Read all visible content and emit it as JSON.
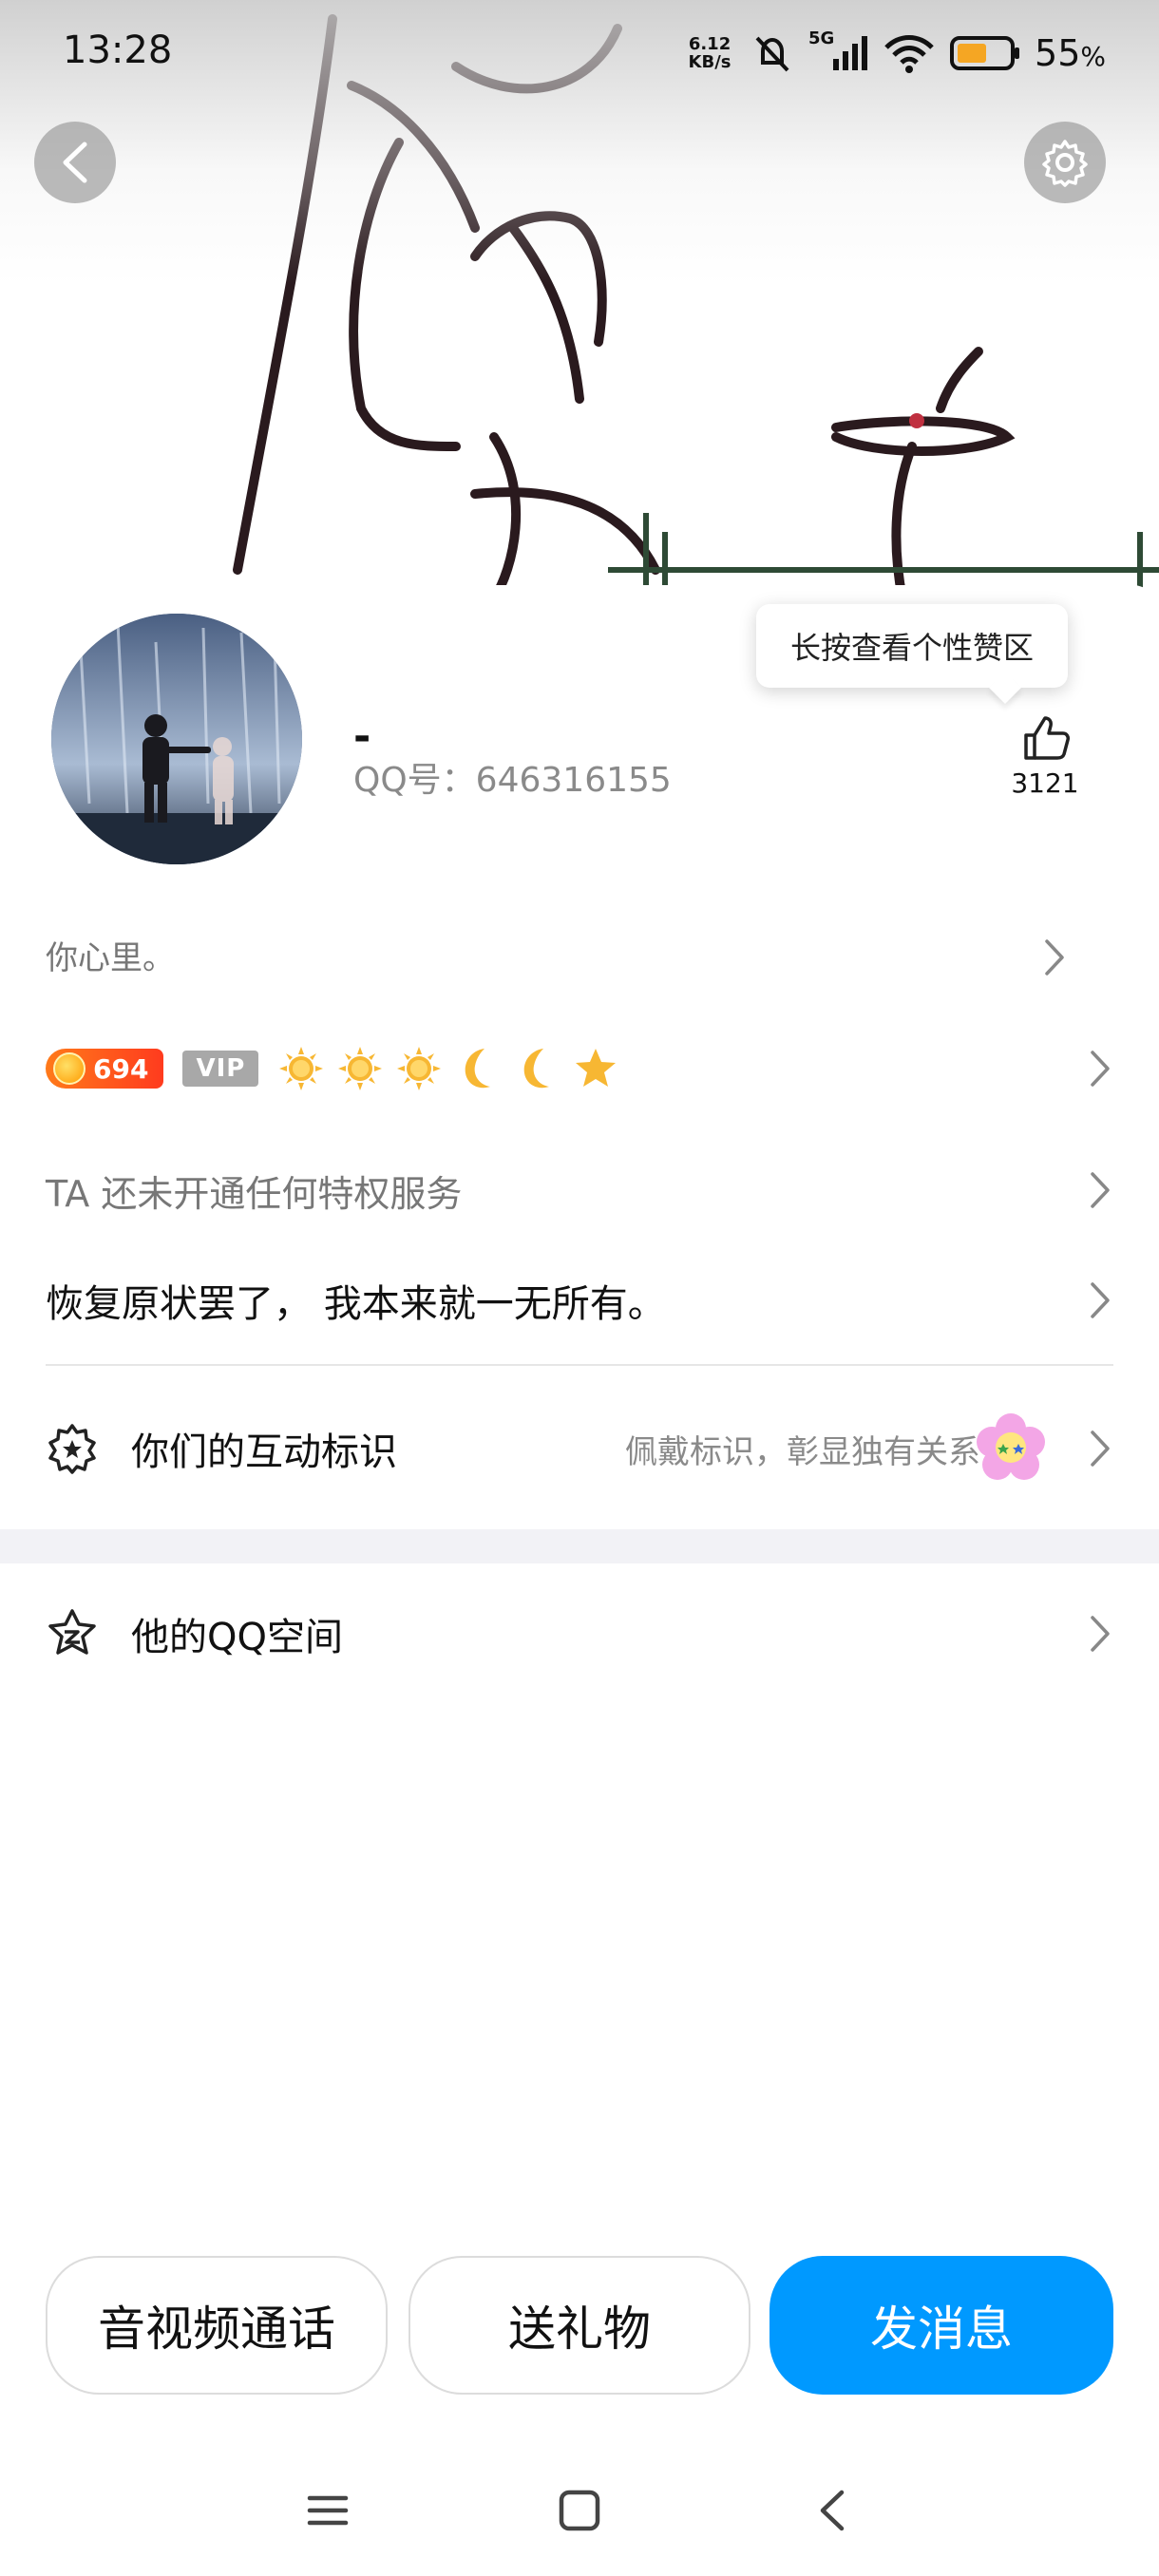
{
  "status_bar": {
    "time": "13:28",
    "net_speed_value": "6.12",
    "net_speed_unit": "KB/s",
    "battery_percent": "55",
    "battery_unit": "%",
    "network": "5G"
  },
  "profile": {
    "nickname": "-",
    "qq_number": "QQ号：646316155",
    "like_tooltip": "长按查看个性赞区",
    "like_count": "3121",
    "signature": "你心里。",
    "level_number": "694",
    "vip_label": "VIP",
    "level_icons": [
      "sun-icon",
      "sun-icon",
      "sun-icon",
      "moon-icon",
      "moon-icon",
      "star-icon"
    ],
    "privilege_text": "TA 还未开通任何特权服务",
    "motto": "恢复原状罢了， 我本来就一无所有。"
  },
  "interaction": {
    "label": "你们的互动标识",
    "hint": "佩戴标识，彰显独有关系"
  },
  "qzone": {
    "label": "他的QQ空间"
  },
  "actions": {
    "call": "音视频通话",
    "gift": "送礼物",
    "message": "发消息"
  },
  "colors": {
    "primary": "#0099ff",
    "level_badge": "#ff4d1f",
    "vip_gray": "#a8a8a8",
    "muted_text": "#8a8a8a"
  }
}
